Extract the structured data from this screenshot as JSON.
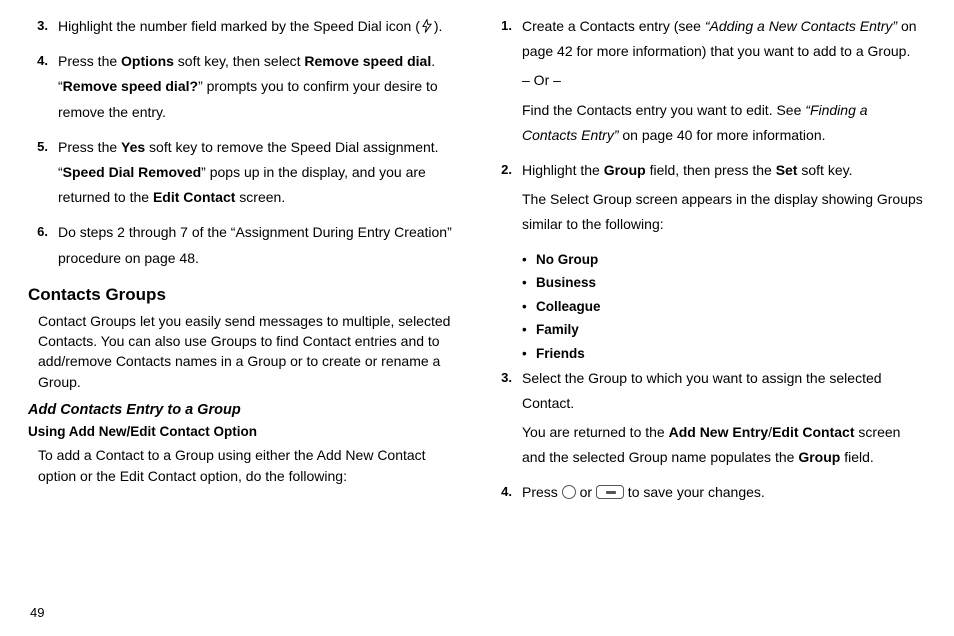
{
  "page_number": "49",
  "left": {
    "steps": [
      {
        "num": "3.",
        "parts": [
          {
            "t": "Highlight the number field marked by the Speed Dial icon ("
          },
          {
            "icon": "bolt"
          },
          {
            "t": ")."
          }
        ]
      },
      {
        "num": "4.",
        "parts": [
          {
            "t": "Press the "
          },
          {
            "b": "Options"
          },
          {
            "t": " soft key, then select "
          },
          {
            "b": "Remove speed dial"
          },
          {
            "t": ". “"
          },
          {
            "b": "Remove speed dial?"
          },
          {
            "t": "” prompts you to confirm your desire to remove the entry."
          }
        ]
      },
      {
        "num": "5.",
        "parts": [
          {
            "t": "Press the "
          },
          {
            "b": "Yes"
          },
          {
            "t": " soft key to remove the Speed Dial assignment. “"
          },
          {
            "b": "Speed Dial Removed"
          },
          {
            "t": "” pops up in the display, and you are returned to the "
          },
          {
            "b": "Edit Contact"
          },
          {
            "t": " screen."
          }
        ]
      },
      {
        "num": "6.",
        "parts": [
          {
            "t": "Do steps 2 through 7 of the “Assignment During Entry Creation” procedure on page 48."
          }
        ]
      }
    ],
    "heading": "Contacts Groups",
    "heading_body": "Contact Groups let you easily send messages to multiple, selected Contacts. You can also use Groups to find Contact entries and to add/remove Contacts names in a Group or to create or rename a Group.",
    "sub": "Add Contacts Entry to a Group",
    "subsub": "Using Add New/Edit Contact Option",
    "subsub_body": "To add a Contact to a Group using either the Add New Contact option or the Edit Contact option, do the following:"
  },
  "right": {
    "steps_a": [
      {
        "num": "1.",
        "paras": [
          [
            {
              "t": "Create a Contacts entry (see "
            },
            {
              "bi": "“Adding a New Contacts Entry”"
            },
            {
              "t": " on page 42 for more information) that you want to add to a Group."
            }
          ],
          [
            {
              "t": "– Or –"
            }
          ],
          [
            {
              "t": "Find the Contacts entry you want to edit. See "
            },
            {
              "bi": "“Finding a Contacts Entry”"
            },
            {
              "t": " on page 40 for more information."
            }
          ]
        ]
      },
      {
        "num": "2.",
        "paras": [
          [
            {
              "t": "Highlight the "
            },
            {
              "b": "Group"
            },
            {
              "t": " field, then press the "
            },
            {
              "b": "Set"
            },
            {
              "t": " soft key."
            }
          ],
          [
            {
              "t": "The Select Group screen appears in the display showing Groups similar to the following:"
            }
          ]
        ]
      }
    ],
    "bullets": [
      "No Group",
      "Business",
      "Colleague",
      "Family",
      "Friends"
    ],
    "steps_b": [
      {
        "num": "3.",
        "paras": [
          [
            {
              "t": "Select the Group to which you want to assign the selected Contact."
            }
          ],
          [
            {
              "t": "You are returned to the "
            },
            {
              "b": "Add New Entry"
            },
            {
              "t": "/"
            },
            {
              "b": "Edit Contact"
            },
            {
              "t": " screen and the selected Group name populates the "
            },
            {
              "b": "Group"
            },
            {
              "t": " field."
            }
          ]
        ]
      },
      {
        "num": "4.",
        "paras": [
          [
            {
              "t": "Press "
            },
            {
              "icon": "circle"
            },
            {
              "t": " or "
            },
            {
              "icon": "ok"
            },
            {
              "t": " to save your changes."
            }
          ]
        ]
      }
    ]
  }
}
